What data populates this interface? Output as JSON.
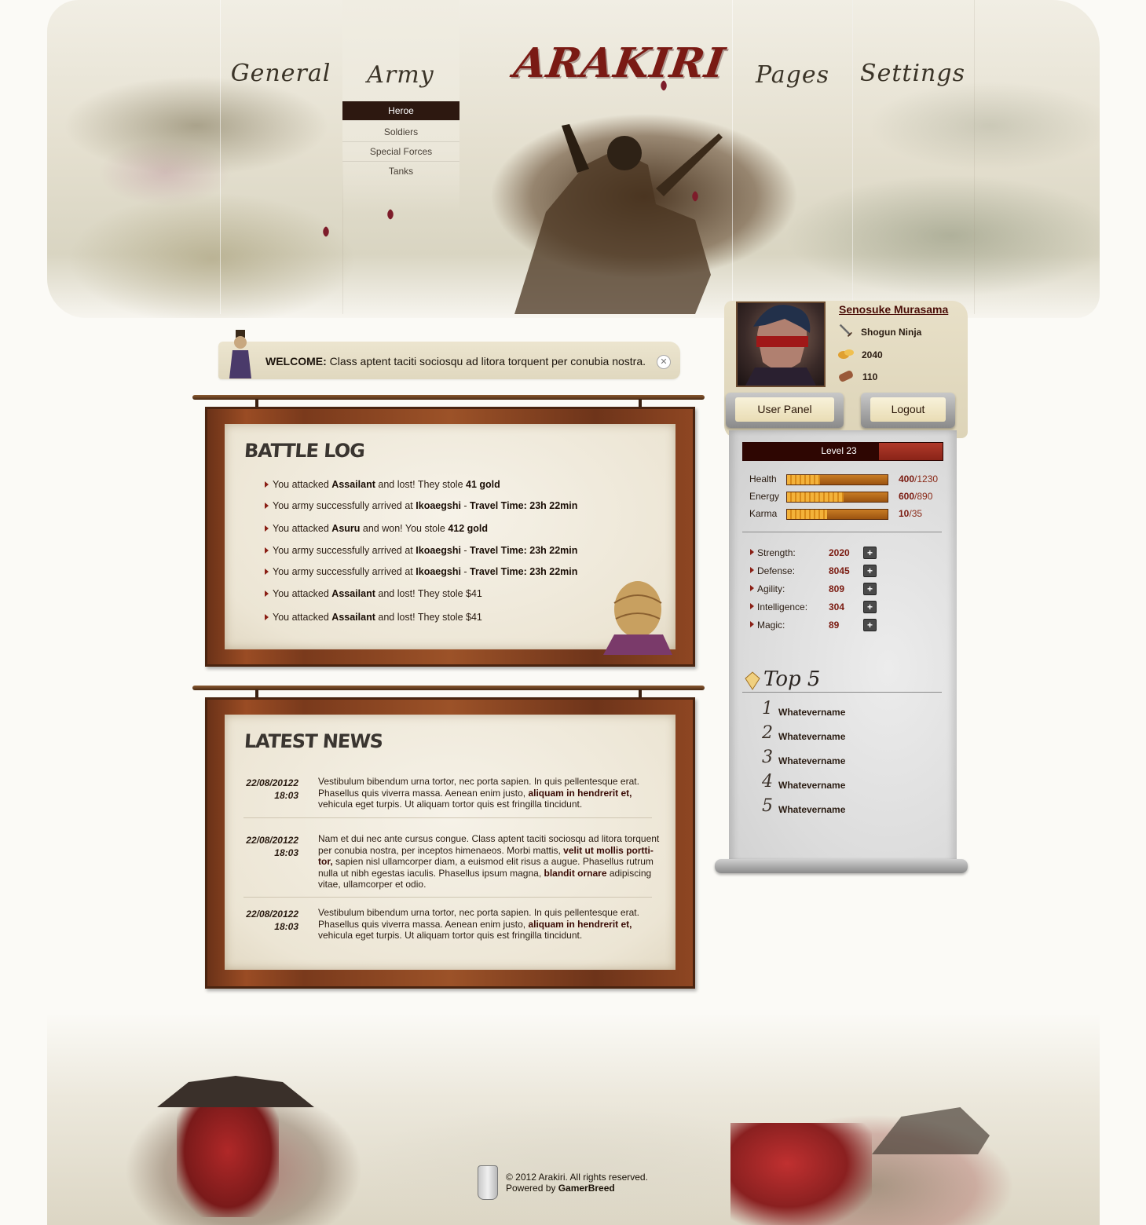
{
  "nav": {
    "general": "General",
    "army": "Army",
    "pages": "Pages",
    "settings": "Settings",
    "logo": "ARAKIRI",
    "army_submenu": [
      "Heroe",
      "Soldiers",
      "Special Forces",
      "Tanks"
    ],
    "active_submenu": "Heroe"
  },
  "welcome": {
    "label": "WELCOME:",
    "text": "Class aptent taciti sociosqu ad litora torquent per conubia nostra."
  },
  "battle_log": {
    "title": "BATTLE LOG",
    "items": [
      {
        "pre": "You attacked ",
        "b1": "Assailant",
        "mid": " and lost! They stole ",
        "b2": "41 gold",
        "post": ""
      },
      {
        "pre": "You army successfully arrived at ",
        "b1": "Ikoaegshi",
        "mid": " - ",
        "b2": "Travel Time: 23h 22min",
        "post": ""
      },
      {
        "pre": "You attacked ",
        "b1": "Asuru",
        "mid": " and won! You stole ",
        "b2": "412 gold",
        "post": ""
      },
      {
        "pre": "You army successfully arrived at ",
        "b1": "Ikoaegshi",
        "mid": " - ",
        "b2": "Travel Time: 23h 22min",
        "post": ""
      },
      {
        "pre": "You army successfully arrived at ",
        "b1": "Ikoaegshi",
        "mid": " - ",
        "b2": "Travel Time: 23h 22min",
        "post": ""
      },
      {
        "pre": "You attacked ",
        "b1": "Assailant",
        "mid": " and lost! They stole $41",
        "b2": "",
        "post": ""
      },
      {
        "pre": "You attacked ",
        "b1": "Assailant",
        "mid": " and lost! They stole $41",
        "b2": "",
        "post": ""
      }
    ]
  },
  "latest_news": {
    "title": "LATEST NEWS",
    "items": [
      {
        "date": "22/08/20122",
        "time": "18:03",
        "t1": "Vestibulum bibendum urna tortor, nec porta sapien. In quis pellentesque erat. Phasellus quis viverra massa. Aenean enim justo, ",
        "b1": "aliquam in hendrerit et,",
        "t2": " vehicula eget turpis. Ut aliquam tortor quis est fringilla tincidunt.",
        "b2": "",
        "t3": ""
      },
      {
        "date": "22/08/20122",
        "time": "18:03",
        "t1": "Nam et dui nec ante cursus congue. Class aptent taciti sociosqu ad litora torquent per conubia nostra, per inceptos himenaeos. Morbi mattis, ",
        "b1": "velit ut mollis portti-tor,",
        "t2": " sapien nisl ullamcorper diam, a euismod elit risus a augue. Phasellus rutrum nulla ut nibh egestas iaculis. Phasellus ipsum magna, ",
        "b2": "blandit ornare",
        "t3": " adipiscing vitae, ullamcorper et odio."
      },
      {
        "date": "22/08/20122",
        "time": "18:03",
        "t1": "Vestibulum bibendum urna tortor, nec porta sapien. In quis pellentesque erat. Phasellus quis viverra massa. Aenean enim justo, ",
        "b1": "aliquam in hendrerit et,",
        "t2": " vehicula eget turpis. Ut aliquam tortor quis est fringilla tincidunt.",
        "b2": "",
        "t3": ""
      }
    ]
  },
  "player": {
    "name": "Senosuke Murasama",
    "class": "Shogun Ninja",
    "gold": "2040",
    "wood": "110",
    "user_panel": "User Panel",
    "logout": "Logout",
    "level": "Level 23",
    "level_progress": 0.68,
    "bars": [
      {
        "label": "Health",
        "value": "400",
        "max": "/1230",
        "fraction": 0.325
      },
      {
        "label": "Energy",
        "value": "600",
        "max": "/890",
        "fraction": 0.56
      },
      {
        "label": "Karma",
        "value": "10",
        "max": "/35",
        "fraction": 0.4
      }
    ],
    "attributes": [
      {
        "label": "Strength:",
        "value": "2020"
      },
      {
        "label": "Defense:",
        "value": "8045"
      },
      {
        "label": "Agility:",
        "value": "809"
      },
      {
        "label": "Intelligence:",
        "value": "304"
      },
      {
        "label": "Magic:",
        "value": "89"
      }
    ],
    "plus_symbol": "+"
  },
  "top5": {
    "title": "Top 5",
    "items": [
      {
        "rank": "1",
        "name": "Whatevername"
      },
      {
        "rank": "2",
        "name": "Whatevername"
      },
      {
        "rank": "3",
        "name": "Whatevername"
      },
      {
        "rank": "4",
        "name": "Whatevername"
      },
      {
        "rank": "5",
        "name": "Whatevername"
      }
    ]
  },
  "footer": {
    "copyright": "© 2012 Arakiri. All rights reserved.",
    "powered_by": "Powered by ",
    "company": "GamerBreed"
  },
  "colors": {
    "accent_dark_red": "#4a0a04",
    "wood_brown": "#7a3a1c",
    "active_menu_bg": "#2d1810",
    "link_red": "#7a1a10"
  }
}
